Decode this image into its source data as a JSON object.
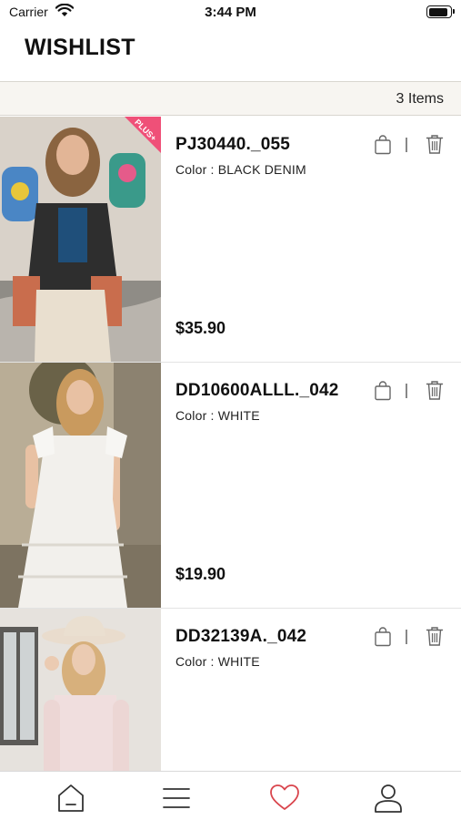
{
  "status_bar": {
    "carrier": "Carrier",
    "time": "3:44 PM",
    "battery_level": 0.9
  },
  "header": {
    "title": "WISHLIST"
  },
  "wishlist": {
    "count_label": "3 Items",
    "items": [
      {
        "name": "PJ30440._055",
        "color": "Color : BLACK DENIM",
        "price": "$35.90",
        "badge": "PLUS+"
      },
      {
        "name": "DD10600ALLL._042",
        "color": "Color : WHITE",
        "price": "$19.90"
      },
      {
        "name": "DD32139A._042",
        "color": "Color : WHITE",
        "price": ""
      }
    ]
  },
  "tab_bar": {
    "tabs": [
      {
        "icon": "home-icon",
        "active": false
      },
      {
        "icon": "menu-icon",
        "active": false
      },
      {
        "icon": "heart-icon",
        "active": true
      },
      {
        "icon": "profile-icon",
        "active": false
      }
    ],
    "active_color": "#d9454d",
    "inactive_color": "#333333"
  }
}
